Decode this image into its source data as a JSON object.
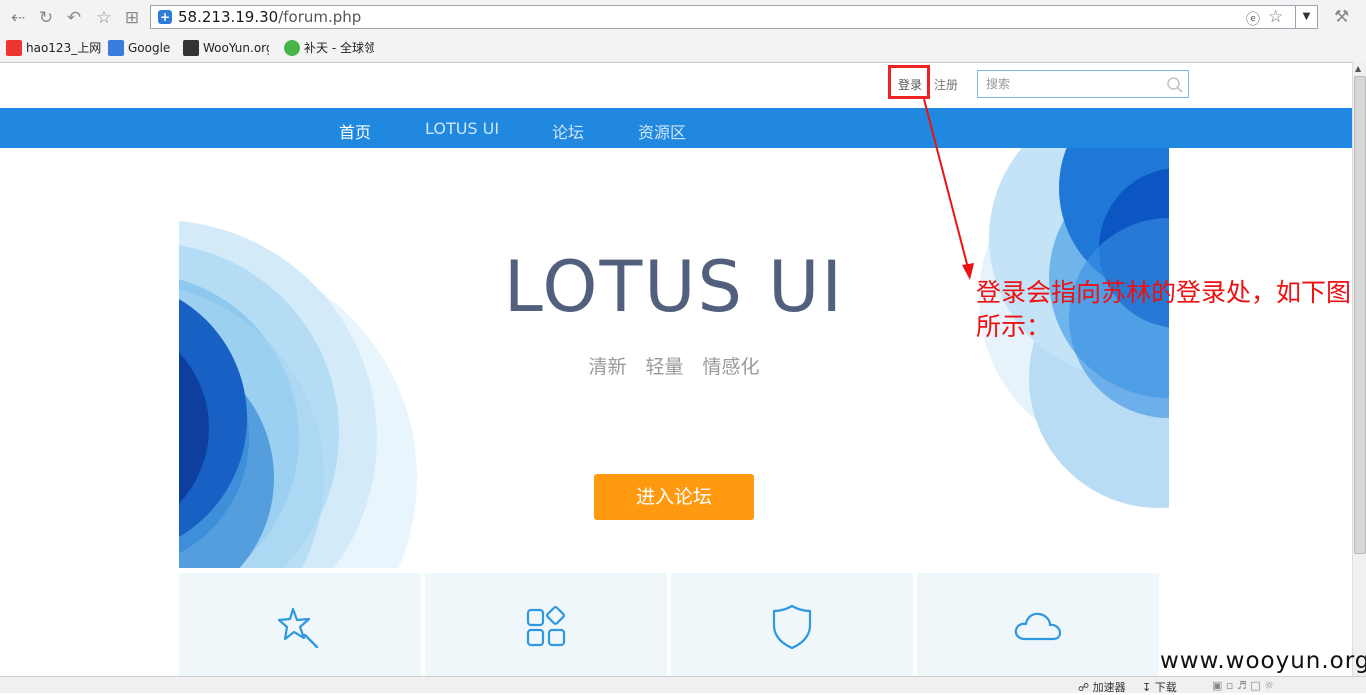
{
  "browser": {
    "url_host": "58.213.19.30",
    "url_path": "/forum.php",
    "bookmarks": [
      {
        "label": "hao123_上网",
        "icon": "hao123-icon"
      },
      {
        "label": "Google",
        "icon": "google-icon"
      },
      {
        "label": "WooYun.org",
        "icon": "wooyun-icon"
      },
      {
        "label": "补天 - 全球领",
        "icon": "butian-icon"
      }
    ],
    "status": {
      "accelerator": "加速器",
      "download": "下载"
    }
  },
  "header": {
    "login": "登录",
    "register": "注册",
    "search_placeholder": "搜索"
  },
  "nav": {
    "items": [
      "首页",
      "LOTUS UI",
      "论坛",
      "资源区"
    ]
  },
  "hero": {
    "title": "LOTUS UI",
    "subtitle": "清新　轻量　情感化",
    "button": "进入论坛"
  },
  "features": [
    {
      "icon": "star-wand-icon"
    },
    {
      "icon": "apps-grid-icon"
    },
    {
      "icon": "shield-icon"
    },
    {
      "icon": "cloud-icon"
    }
  ],
  "annotation": {
    "text": "登录会指向苏林的登录处，如下图所示："
  },
  "watermark": "www.wooyun.org",
  "colors": {
    "nav_bg": "#2188e0",
    "button_bg": "#ff9a10",
    "title_color": "#52607e",
    "annotation_red": "#ee1111"
  }
}
